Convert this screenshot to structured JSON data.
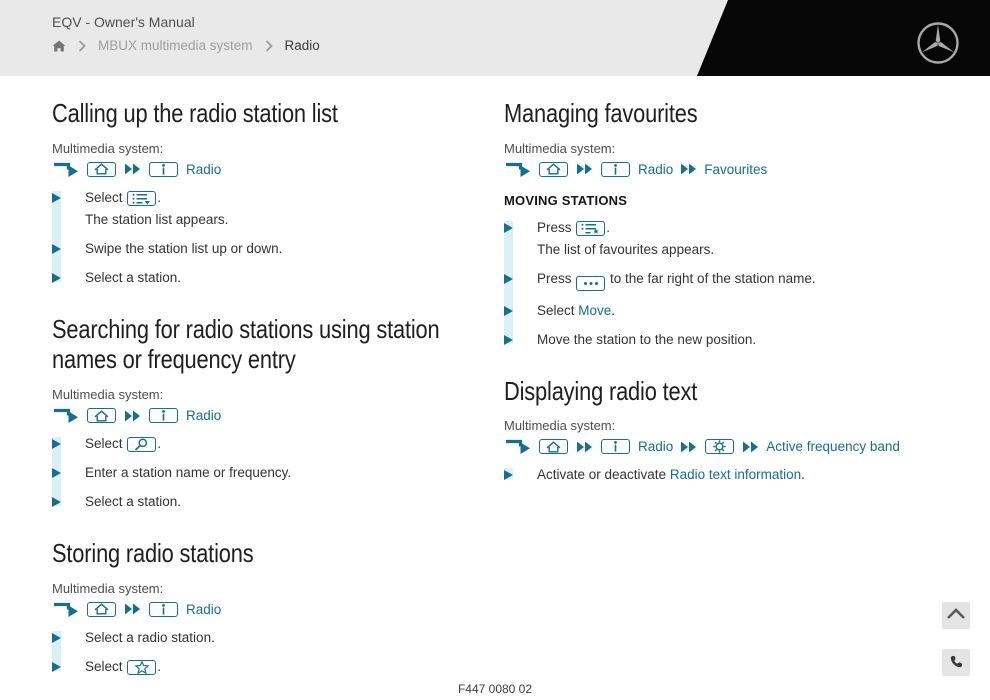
{
  "colors": {
    "accent": "#176e8e",
    "strip": "#d9f1f4",
    "header_bg": "#e9e9e9",
    "wedge": "#070707"
  },
  "header": {
    "title": "EQV - Owner's Manual",
    "breadcrumb": {
      "parent": "MBUX multimedia system",
      "current": "Radio"
    },
    "logo": "mercedes-star-icon"
  },
  "columns": {
    "left": [
      {
        "title_lines": [
          "Calling up the radio station list"
        ],
        "system_label": "Multimedia system:",
        "path": [
          {
            "t": "arrow"
          },
          {
            "t": "box",
            "icon": "home"
          },
          {
            "t": "chevrons"
          },
          {
            "t": "box",
            "icon": "info"
          },
          {
            "t": "text",
            "v": "Radio"
          }
        ],
        "steps": [
          {
            "bullet": true,
            "parts": [
              {
                "t": "text",
                "v": "Select "
              },
              {
                "t": "box",
                "icon": "station-list"
              },
              {
                "t": "text",
                "v": "."
              }
            ]
          },
          {
            "bullet": false,
            "parts": [
              {
                "t": "text",
                "v": "The station list appears."
              }
            ]
          },
          {
            "bullet": true,
            "parts": [
              {
                "t": "text",
                "v": "Swipe the station list up or down."
              }
            ]
          },
          {
            "bullet": true,
            "parts": [
              {
                "t": "text",
                "v": "Select a station."
              }
            ]
          }
        ]
      },
      {
        "title_lines": [
          "Searching for radio stations using station",
          "names or frequency entry"
        ],
        "system_label": "Multimedia system:",
        "path": [
          {
            "t": "arrow"
          },
          {
            "t": "box",
            "icon": "home"
          },
          {
            "t": "chevrons"
          },
          {
            "t": "box",
            "icon": "info"
          },
          {
            "t": "text",
            "v": "Radio"
          }
        ],
        "steps": [
          {
            "bullet": true,
            "parts": [
              {
                "t": "text",
                "v": "Select "
              },
              {
                "t": "box",
                "icon": "search"
              },
              {
                "t": "text",
                "v": "."
              }
            ]
          },
          {
            "bullet": true,
            "parts": [
              {
                "t": "text",
                "v": "Enter a station name or frequency."
              }
            ]
          },
          {
            "bullet": true,
            "parts": [
              {
                "t": "text",
                "v": "Select a station."
              }
            ]
          }
        ]
      },
      {
        "title_lines": [
          "Storing radio stations"
        ],
        "system_label": "Multimedia system:",
        "path": [
          {
            "t": "arrow"
          },
          {
            "t": "box",
            "icon": "home"
          },
          {
            "t": "chevrons"
          },
          {
            "t": "box",
            "icon": "info"
          },
          {
            "t": "text",
            "v": "Radio"
          }
        ],
        "steps": [
          {
            "bullet": true,
            "parts": [
              {
                "t": "text",
                "v": "Select a radio station."
              }
            ]
          },
          {
            "bullet": true,
            "parts": [
              {
                "t": "text",
                "v": "Select "
              },
              {
                "t": "box",
                "icon": "star"
              },
              {
                "t": "text",
                "v": "."
              }
            ]
          }
        ]
      }
    ],
    "right": [
      {
        "title_lines": [
          "Managing favourites"
        ],
        "system_label": "Multimedia system:",
        "path": [
          {
            "t": "arrow"
          },
          {
            "t": "box",
            "icon": "home"
          },
          {
            "t": "chevrons"
          },
          {
            "t": "box",
            "icon": "info"
          },
          {
            "t": "text",
            "v": "Radio"
          },
          {
            "t": "chevrons"
          },
          {
            "t": "text",
            "v": "Favourites"
          }
        ],
        "subheading": "MOVING STATIONS",
        "steps": [
          {
            "bullet": true,
            "parts": [
              {
                "t": "text",
                "v": "Press "
              },
              {
                "t": "box",
                "icon": "list-star"
              },
              {
                "t": "text",
                "v": "."
              }
            ]
          },
          {
            "bullet": false,
            "parts": [
              {
                "t": "text",
                "v": "The list of favourites appears."
              }
            ]
          },
          {
            "bullet": true,
            "parts": [
              {
                "t": "text",
                "v": "Press "
              },
              {
                "t": "box",
                "icon": "dots"
              },
              {
                "t": "text",
                "v": " to the far right of the station name."
              }
            ]
          },
          {
            "bullet": true,
            "parts": [
              {
                "t": "text",
                "v": "Select "
              },
              {
                "t": "link",
                "v": "Move"
              },
              {
                "t": "text",
                "v": "."
              }
            ]
          },
          {
            "bullet": true,
            "parts": [
              {
                "t": "text",
                "v": "Move the station to the new position."
              }
            ]
          }
        ]
      },
      {
        "title_lines": [
          "Displaying radio text"
        ],
        "system_label": "Multimedia system:",
        "path": [
          {
            "t": "arrow"
          },
          {
            "t": "box",
            "icon": "home"
          },
          {
            "t": "chevrons"
          },
          {
            "t": "box",
            "icon": "info"
          },
          {
            "t": "text",
            "v": "Radio"
          },
          {
            "t": "chevrons"
          },
          {
            "t": "box",
            "icon": "gear"
          },
          {
            "t": "chevrons"
          },
          {
            "t": "text",
            "v": "Active frequency band"
          }
        ],
        "steps": [
          {
            "bullet": true,
            "parts": [
              {
                "t": "text",
                "v": "Activate or deactivate "
              },
              {
                "t": "link",
                "v": "Radio text information"
              },
              {
                "t": "text",
                "v": "."
              }
            ]
          }
        ]
      }
    ]
  },
  "floating": {
    "scroll_top": "chevron-up-icon",
    "contact": "phone-icon"
  },
  "footer": {
    "code": "F447 0080 02"
  }
}
